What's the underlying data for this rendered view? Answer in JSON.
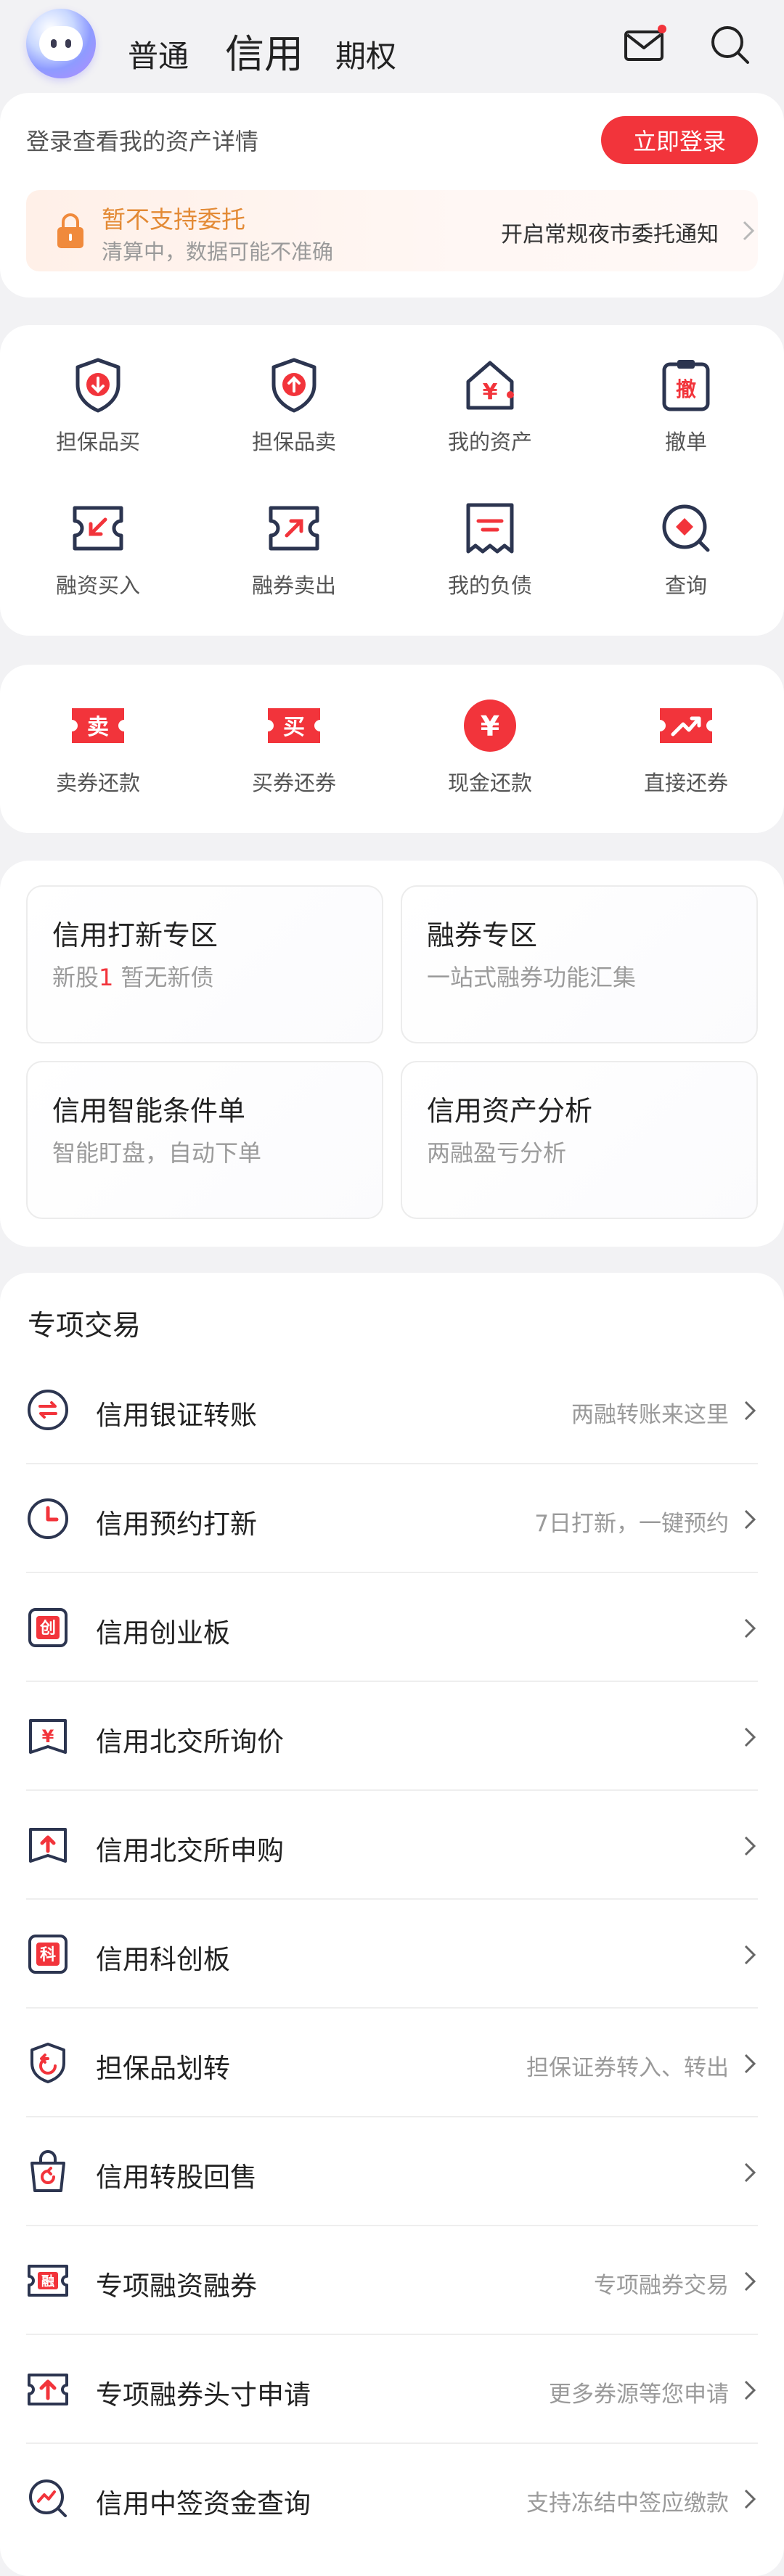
{
  "header": {
    "tabs": [
      "普通",
      "信用",
      "期权"
    ]
  },
  "login": {
    "tip": "登录查看我的资产详情",
    "button": "立即登录"
  },
  "notice": {
    "title": "暂不支持委托",
    "subtitle": "清算中，数据可能不准确",
    "link": "开启常规夜市委托通知"
  },
  "grid": [
    {
      "label": "担保品买",
      "icon": "shield-down-icon"
    },
    {
      "label": "担保品卖",
      "icon": "shield-up-icon"
    },
    {
      "label": "我的资产",
      "icon": "house-yen-icon"
    },
    {
      "label": "撤单",
      "icon": "clipboard-cancel-icon"
    },
    {
      "label": "融资买入",
      "icon": "ticket-arrow-in-icon"
    },
    {
      "label": "融券卖出",
      "icon": "ticket-arrow-out-icon"
    },
    {
      "label": "我的负债",
      "icon": "receipt-icon"
    },
    {
      "label": "查询",
      "icon": "search-diamond-icon"
    }
  ],
  "repay": [
    {
      "label": "卖券还款",
      "glyph": "卖"
    },
    {
      "label": "买券还券",
      "glyph": "买"
    },
    {
      "label": "现金还款",
      "glyph": "¥"
    },
    {
      "label": "直接还券",
      "glyph": ""
    }
  ],
  "zones": [
    {
      "title": "信用打新专区",
      "sub_prefix": "新股",
      "sub_highlight": "1",
      "sub_suffix": " 暂无新债"
    },
    {
      "title": "融券专区",
      "sub_prefix": "一站式融券功能汇集",
      "sub_highlight": "",
      "sub_suffix": ""
    },
    {
      "title": "信用智能条件单",
      "sub_prefix": "智能盯盘，自动下单",
      "sub_highlight": "",
      "sub_suffix": ""
    },
    {
      "title": "信用资产分析",
      "sub_prefix": "两融盈亏分析",
      "sub_highlight": "",
      "sub_suffix": ""
    }
  ],
  "special": {
    "title": "专项交易",
    "rows": [
      {
        "title": "信用银证转账",
        "hint": "两融转账来这里",
        "glyph": "⇄"
      },
      {
        "title": "信用预约打新",
        "hint": "7日打新，一键预约",
        "glyph": ""
      },
      {
        "title": "信用创业板",
        "hint": "",
        "glyph": "创"
      },
      {
        "title": "信用北交所询价",
        "hint": "",
        "glyph": "¥"
      },
      {
        "title": "信用北交所申购",
        "hint": "",
        "glyph": "↑"
      },
      {
        "title": "信用科创板",
        "hint": "",
        "glyph": "科"
      },
      {
        "title": "担保品划转",
        "hint": "担保证券转入、转出",
        "glyph": "⟲"
      },
      {
        "title": "信用转股回售",
        "hint": "",
        "glyph": "↻"
      },
      {
        "title": "专项融资融券",
        "hint": "专项融券交易",
        "glyph": "融"
      },
      {
        "title": "专项融券头寸申请",
        "hint": "更多券源等您申请",
        "glyph": "↑"
      },
      {
        "title": "信用中签资金查询",
        "hint": "支持冻结中签应缴款",
        "glyph": ""
      }
    ]
  },
  "colors": {
    "accent": "#f2343b",
    "notice": "#e38a35",
    "icon_dark": "#2c3550"
  }
}
